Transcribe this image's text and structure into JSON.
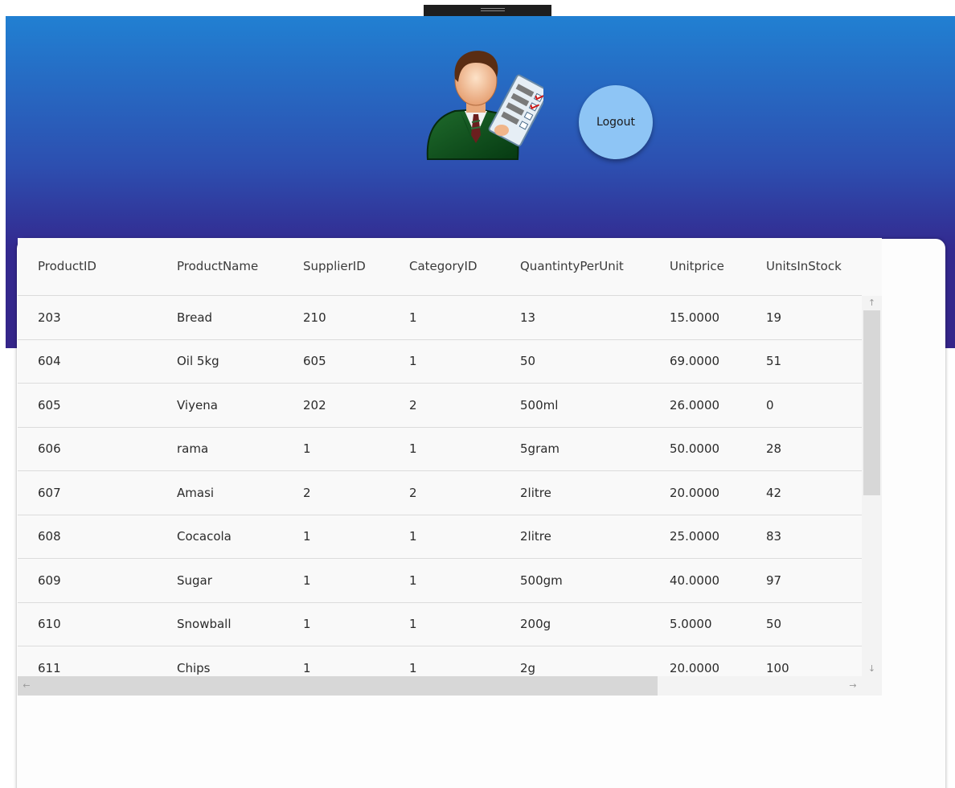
{
  "header": {
    "logout_label": "Logout"
  },
  "colors": {
    "header_top": "#2180d2",
    "header_bottom": "#352589",
    "logout_bg": "#8ec5f5"
  },
  "table": {
    "columns": [
      "ProductID",
      "ProductName",
      "SupplierID",
      "CategoryID",
      "QuantintyPerUnit",
      "Unitprice",
      "UnitsInStock"
    ],
    "rows": [
      [
        "203",
        "Bread",
        "210",
        "1",
        "13",
        "15.0000",
        "19"
      ],
      [
        "604",
        "Oil 5kg",
        "605",
        "1",
        "50",
        "69.0000",
        "51"
      ],
      [
        "605",
        "Viyena",
        "202",
        "2",
        "500ml",
        "26.0000",
        "0"
      ],
      [
        "606",
        "rama",
        "1",
        "1",
        "5gram",
        "50.0000",
        "28"
      ],
      [
        "607",
        "Amasi",
        "2",
        "2",
        "2litre",
        "20.0000",
        "42"
      ],
      [
        "608",
        "Cocacola",
        "1",
        "1",
        "2litre",
        "25.0000",
        "83"
      ],
      [
        "609",
        "Sugar",
        "1",
        "1",
        "500gm",
        "40.0000",
        "97"
      ],
      [
        "610",
        "Snowball",
        "1",
        "1",
        "200g",
        "5.0000",
        "50"
      ],
      [
        "611",
        "Chips",
        "1",
        "1",
        "2g",
        "20.0000",
        "100"
      ]
    ]
  },
  "icons": {
    "avatar": "businessman-with-checklist-icon",
    "scroll_up": "arrow-up-icon",
    "scroll_down": "arrow-down-icon",
    "scroll_left": "arrow-left-icon",
    "scroll_right": "arrow-right-icon"
  }
}
